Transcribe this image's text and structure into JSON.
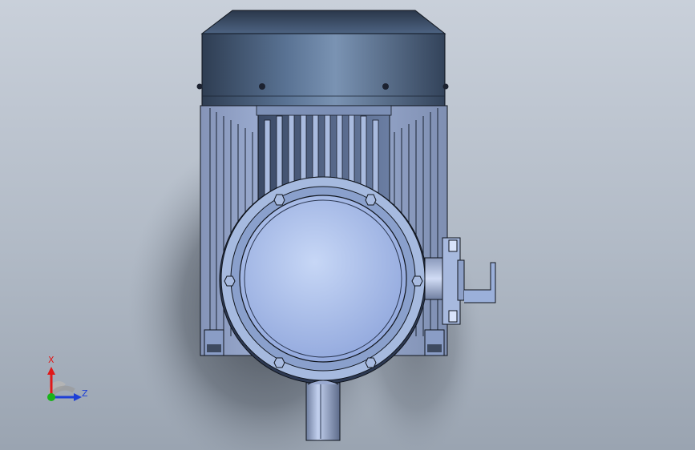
{
  "viewport": {
    "background_top": "#c9d0da",
    "background_bottom": "#9aa4b1"
  },
  "model": {
    "part": "electric-motor-front-view",
    "body_color": "#8a9dc6",
    "shroud_color": "#4a6080",
    "flange_color": "#b4c8ef"
  },
  "triad": {
    "x_label": "X",
    "z_label": "Z",
    "x_color": "#e01818",
    "z_color": "#1d3fd6",
    "origin_color": "#19b319"
  }
}
